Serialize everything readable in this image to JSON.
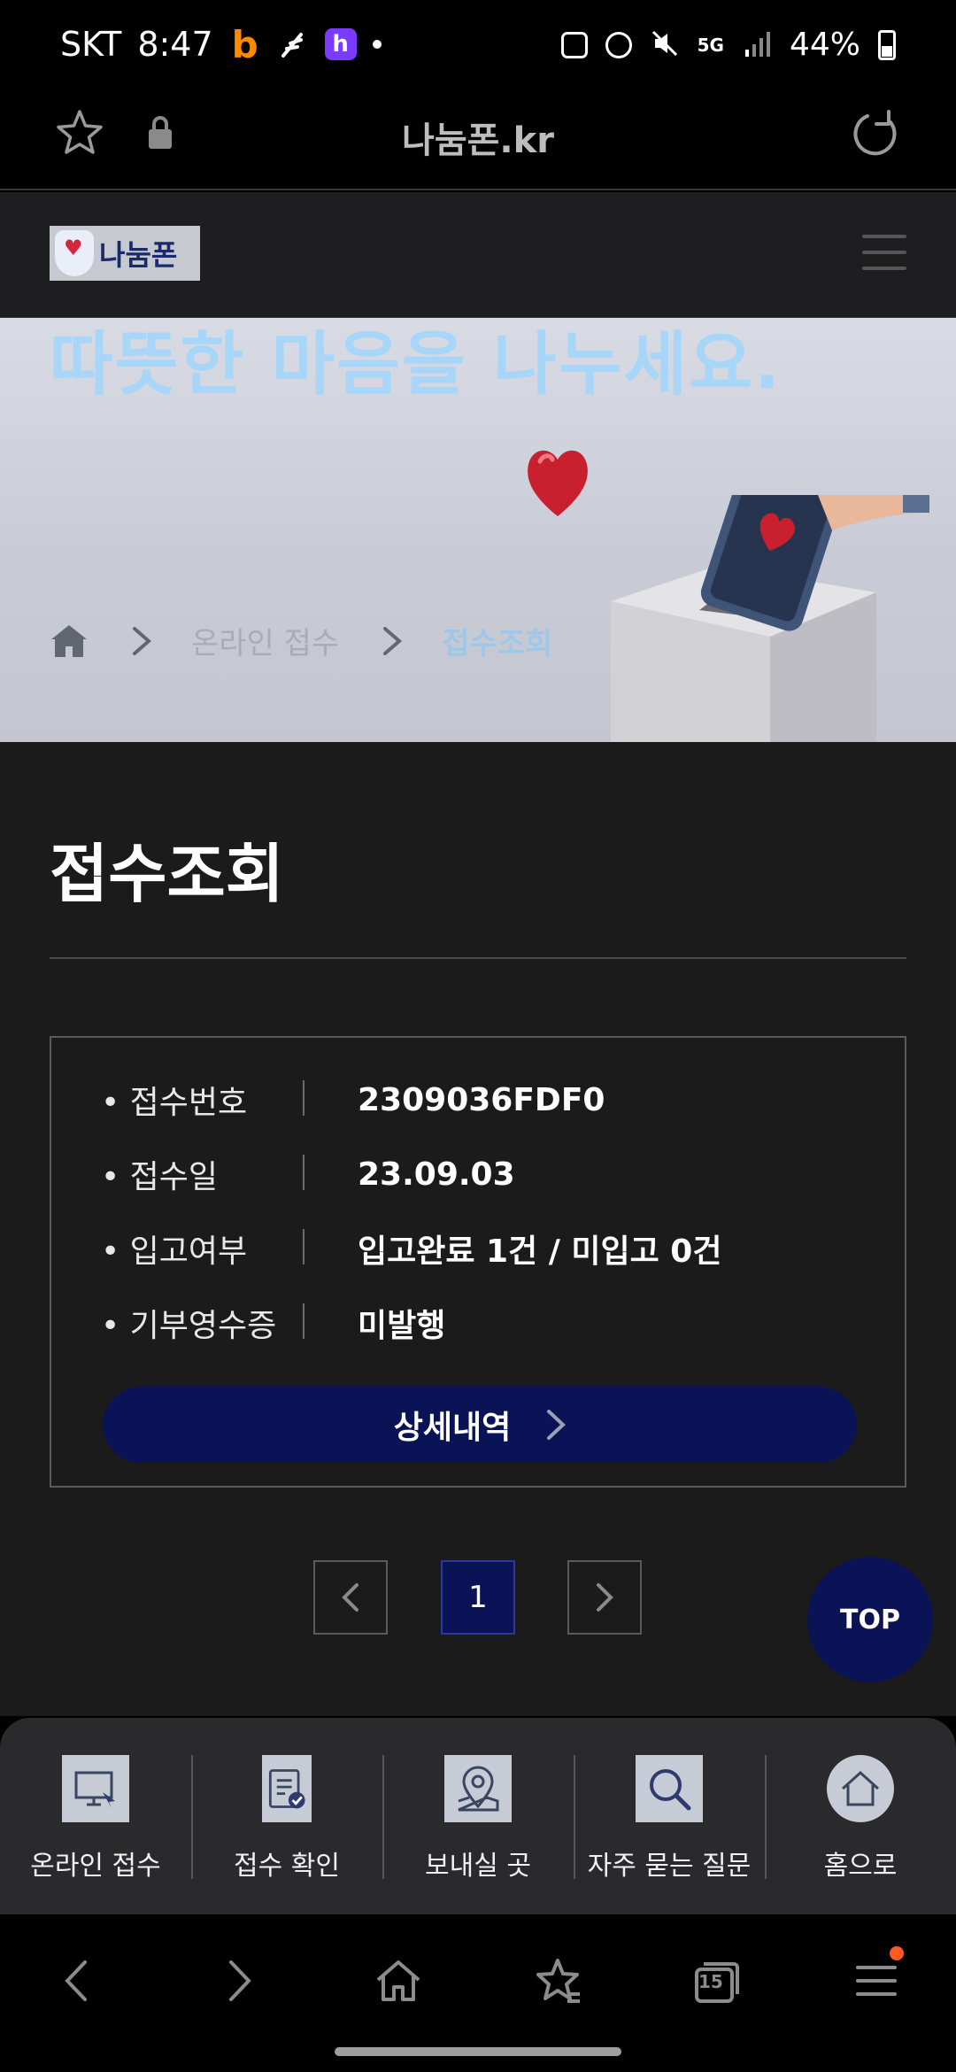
{
  "status_bar": {
    "carrier": "SKT",
    "time": "8:47",
    "battery": "44%",
    "network": "5G",
    "h_app_letter": "h",
    "b_app_letter": "b"
  },
  "browser": {
    "url": "나눔폰.kr"
  },
  "site": {
    "logo_text": "나눔폰"
  },
  "hero": {
    "title": "따뜻한 마음을 나누세요.",
    "breadcrumb": [
      "온라인 접수",
      "접수조회"
    ]
  },
  "page": {
    "title": "접수조회"
  },
  "receipt": {
    "rows": [
      {
        "label": "• 접수번호",
        "value": "2309036FDF0"
      },
      {
        "label": "• 접수일",
        "value": "23.09.03"
      },
      {
        "label": "• 입고여부",
        "value": "입고완료 1건 / 미입고 0건"
      },
      {
        "label": "• 기부영수증",
        "value": "미발행"
      }
    ],
    "detail_button": "상세내역"
  },
  "pagination": {
    "current_page": "1"
  },
  "top_button": "TOP",
  "quick_nav": [
    {
      "label": "온라인 접수",
      "icon": "computer-icon"
    },
    {
      "label": "접수 확인",
      "icon": "clipboard-check-icon"
    },
    {
      "label": "보내실 곳",
      "icon": "map-pin-icon"
    },
    {
      "label": "자주 묻는 질문",
      "icon": "search-icon"
    },
    {
      "label": "홈으로",
      "icon": "home-icon"
    }
  ],
  "bottom_bar": {
    "tabs_count": "15"
  },
  "colors": {
    "accent_navy": "#0a1355",
    "hero_title": "#a7d6f8",
    "badge_orange": "#ff5a1f"
  }
}
